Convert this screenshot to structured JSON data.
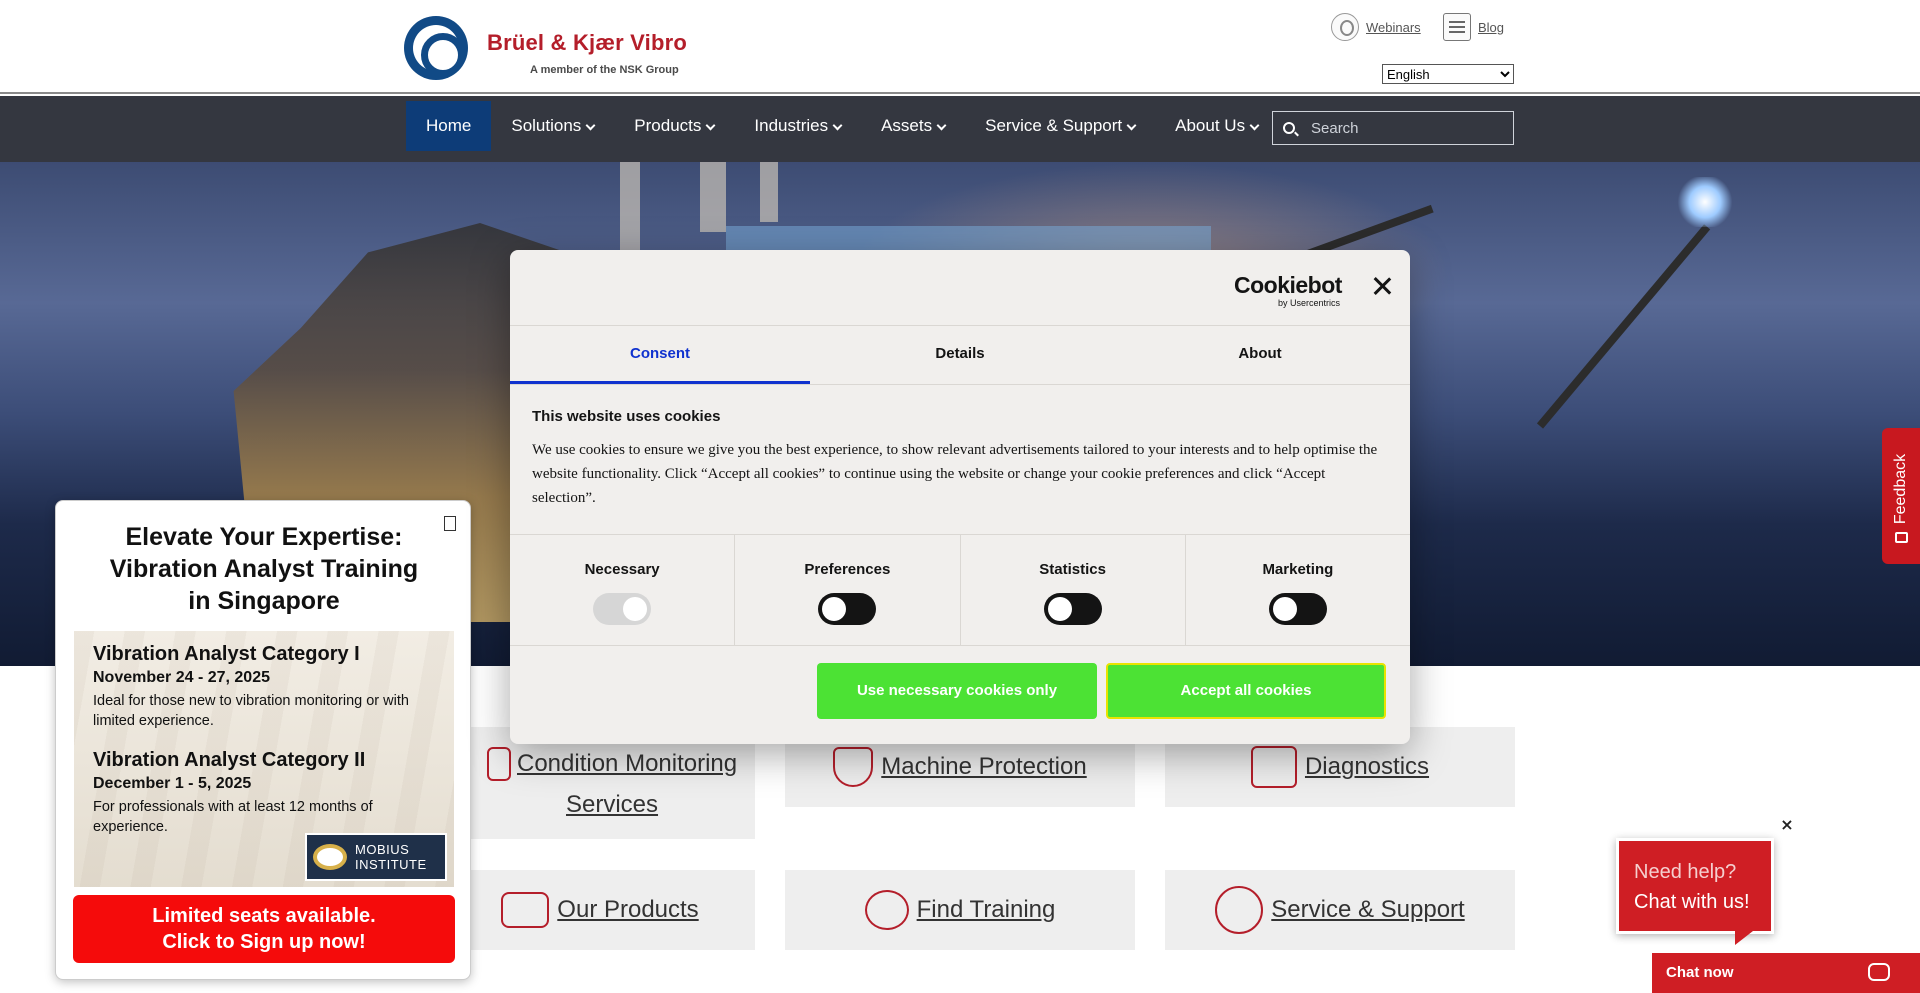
{
  "header": {
    "brand": "Brüel & Kjær Vibro",
    "brand_sub": "A member of the NSK Group",
    "webinars": "Webinars",
    "blog": "Blog",
    "language": "English"
  },
  "nav": {
    "items": [
      "Home",
      "Solutions",
      "Products",
      "Industries",
      "Assets",
      "Service & Support",
      "About Us"
    ],
    "search_placeholder": "Search"
  },
  "tiles": [
    {
      "label": "Condition Monitoring Services",
      "line1": "Condition Monitoring",
      "line2": "Services"
    },
    {
      "label": "Machine Protection"
    },
    {
      "label": "Diagnostics"
    },
    {
      "label": "Our Products"
    },
    {
      "label": "Find Training"
    },
    {
      "label": "Service & Support"
    }
  ],
  "popup": {
    "title_lines": [
      "Elevate Your Expertise:",
      "Vibration Analyst Training",
      "in Singapore"
    ],
    "courses": [
      {
        "name": "Vibration Analyst Category I",
        "date": "November 24 - 27, 2025",
        "desc": "Ideal for those new to vibration monitoring or with limited experience."
      },
      {
        "name": "Vibration Analyst Category II",
        "date": "December 1 - 5, 2025",
        "desc": "For professionals with at least 12 months of experience."
      }
    ],
    "mobius": [
      "MOBIUS",
      "INSTITUTE"
    ],
    "cta_lines": [
      "Limited seats available.",
      "Click to Sign up now!"
    ]
  },
  "cookie": {
    "logo": "Cookiebot",
    "logo_sub": "by Usercentrics",
    "tabs": [
      "Consent",
      "Details",
      "About"
    ],
    "heading": "This website uses cookies",
    "body": "We use cookies to ensure we give you the best experience, to show relevant advertisements tailored to your interests and to help optimise the website functionality. Click “Accept all cookies” to continue using the website or change your cookie preferences and click “Accept selection”.",
    "categories": [
      "Necessary",
      "Preferences",
      "Statistics",
      "Marketing"
    ],
    "btn_necessary": "Use necessary cookies only",
    "btn_accept": "Accept all cookies"
  },
  "feedback": "Feedback",
  "chat": {
    "bubble_line1": "Need help?",
    "bubble_line2": "Chat with us!",
    "close": "×",
    "bar": "Chat now"
  },
  "colors": {
    "brand_red": "#b41e2a",
    "nav_active": "#0d3c78",
    "cookie_accent": "#1032cf",
    "cookie_button": "#4ce234",
    "signup": "#f50b0b",
    "chat": "#cf1e24"
  }
}
